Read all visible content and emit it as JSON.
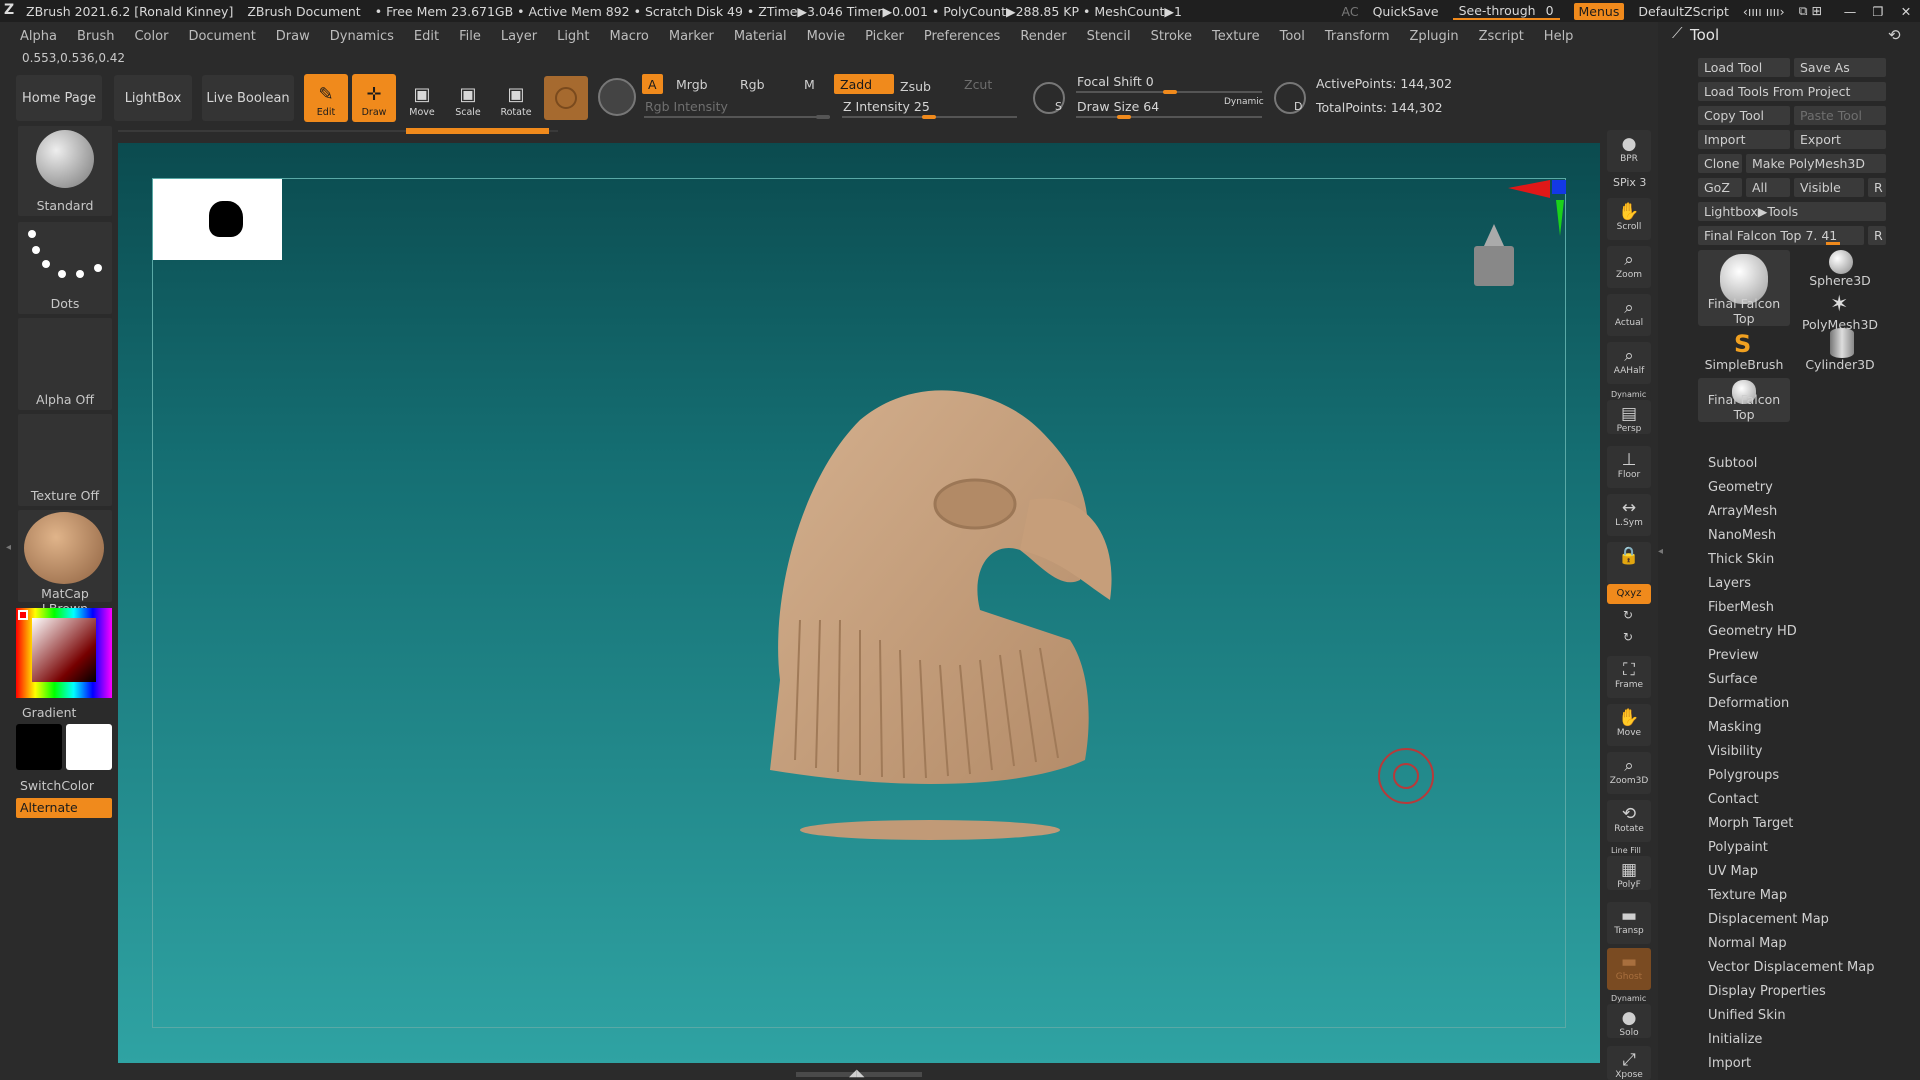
{
  "titlebar": {
    "app": "ZBrush 2021.6.2 [Ronald Kinney]",
    "document": "ZBrush Document",
    "stats": "• Free Mem 23.671GB • Active Mem 892 • Scratch Disk 49 • ZTime▶3.046 Timer▶0.001 • PolyCount▶288.85 KP • MeshCount▶1",
    "ac": "AC",
    "quicksave": "QuickSave",
    "seethrough": "See-through",
    "seethrough_value": "0",
    "menus": "Menus",
    "script": "DefaultZScript"
  },
  "menubar": [
    "Alpha",
    "Brush",
    "Color",
    "Document",
    "Draw",
    "Dynamics",
    "Edit",
    "File",
    "Layer",
    "Light",
    "Macro",
    "Marker",
    "Material",
    "Movie",
    "Picker",
    "Preferences",
    "Render",
    "Stencil",
    "Stroke",
    "Texture",
    "Tool",
    "Transform",
    "Zplugin",
    "Zscript",
    "Help"
  ],
  "coords": "0.553,0.536,0.42",
  "shelf": {
    "home": "Home Page",
    "lightbox": "LightBox",
    "liveboolean": "Live Boolean",
    "edit": "Edit",
    "draw": "Draw",
    "move": "Move",
    "scale": "Scale",
    "rotate": "Rotate",
    "a": "A",
    "mrgb": "Mrgb",
    "rgb": "Rgb",
    "m": "M",
    "zadd": "Zadd",
    "zsub": "Zsub",
    "zcut": "Zcut",
    "rgb_intensity": "Rgb Intensity",
    "z_intensity": "Z Intensity 25",
    "focal_shift": "Focal Shift 0",
    "draw_size": "Draw Size 64",
    "dynamic": "Dynamic",
    "s": "S",
    "d": "D",
    "active_points": "ActivePoints: 144,302",
    "total_points": "TotalPoints: 144,302"
  },
  "left": {
    "brush": "Standard",
    "stroke": "Dots",
    "alpha": "Alpha Off",
    "texture": "Texture Off",
    "material": "MatCap LBrown",
    "gradient": "Gradient",
    "switchcolor": "SwitchColor",
    "alternate": "Alternate"
  },
  "righttool": {
    "bpr": "BPR",
    "spix": "SPix 3",
    "scroll": "Scroll",
    "zoom": "Zoom",
    "actual": "Actual",
    "aahalf": "AAHalf",
    "dynamic": "Dynamic",
    "persp": "Persp",
    "floor": "Floor",
    "lsym": "L.Sym",
    "xyz": "Qxyz",
    "frame": "Frame",
    "move": "Move",
    "zoom3d": "Zoom3D",
    "rotate": "Rotate",
    "linefill": "Line Fill",
    "polyf": "PolyF",
    "transp": "Transp",
    "ghost": "Ghost",
    "dynamic2": "Dynamic",
    "solo": "Solo",
    "xpose": "Xpose"
  },
  "toolpanel": {
    "title": "Tool",
    "load_tool": "Load Tool",
    "save_as": "Save As",
    "load_from_project": "Load Tools From Project",
    "copy_tool": "Copy Tool",
    "paste_tool": "Paste Tool",
    "import": "Import",
    "export": "Export",
    "clone": "Clone",
    "make_polymesh": "Make PolyMesh3D",
    "goz": "GoZ",
    "all": "All",
    "visible": "Visible",
    "r": "R",
    "lightbox_tools": "Lightbox▶Tools",
    "current_tool": "Final Falcon Top 7. 41",
    "tools": [
      "Final Falcon Top",
      "Sphere3D",
      "PolyMesh3D",
      "SimpleBrush",
      "Cylinder3D",
      "Final Falcon Top"
    ]
  },
  "subpalettes": [
    "Subtool",
    "Geometry",
    "ArrayMesh",
    "NanoMesh",
    "Thick Skin",
    "Layers",
    "FiberMesh",
    "Geometry HD",
    "Preview",
    "Surface",
    "Deformation",
    "Masking",
    "Visibility",
    "Polygroups",
    "Contact",
    "Morph Target",
    "Polypaint",
    "UV Map",
    "Texture Map",
    "Displacement Map",
    "Normal Map",
    "Vector Displacement Map",
    "Display Properties",
    "Unified Skin",
    "Initialize",
    "Import"
  ]
}
